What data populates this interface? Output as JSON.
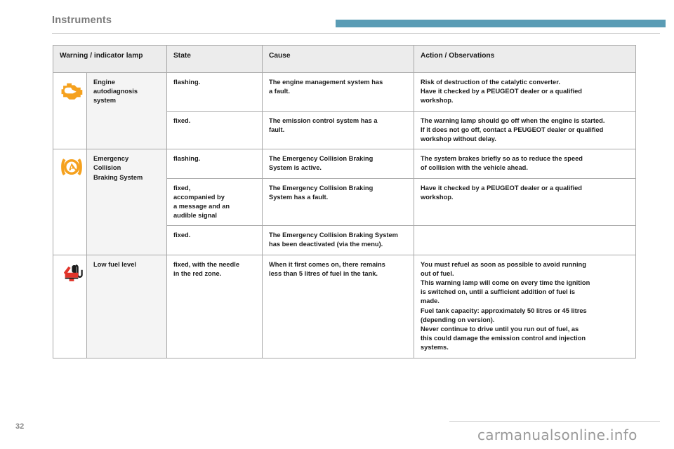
{
  "header": {
    "section_title": "Instruments",
    "accent_color": "#5a9cb5"
  },
  "table": {
    "columns": [
      {
        "key": "lamp",
        "label": "Warning / indicator lamp"
      },
      {
        "key": "state",
        "label": "State"
      },
      {
        "key": "cause",
        "label": "Cause"
      },
      {
        "key": "action",
        "label": "Action / Observations"
      }
    ],
    "groups": [
      {
        "icon": "engine-autodiagnosis-icon",
        "icon_color": "#f5a11e",
        "name_lines": [
          "Engine",
          "autodiagnosis",
          "system"
        ],
        "rows": [
          {
            "state": [
              "flashing."
            ],
            "cause": [
              "The engine management system has",
              "a fault."
            ],
            "action": [
              "Risk of destruction of the catalytic converter.",
              "Have it checked by a PEUGEOT dealer or a qualified",
              "workshop."
            ]
          },
          {
            "state": [
              "fixed."
            ],
            "cause": [
              "The emission control system has a",
              "fault."
            ],
            "action": [
              "The warning lamp should go off when the engine is started.",
              "If it does not go off, contact a PEUGEOT dealer or qualified",
              "workshop without delay."
            ]
          }
        ]
      },
      {
        "icon": "emergency-collision-braking-icon",
        "icon_color": "#f5a11e",
        "name_lines": [
          "Emergency",
          "Collision",
          "Braking System"
        ],
        "rows": [
          {
            "state": [
              "flashing."
            ],
            "cause": [
              "The Emergency Collision Braking",
              "System is active."
            ],
            "action": [
              "The system brakes briefly so as to reduce the speed",
              "of collision with the vehicle ahead."
            ]
          },
          {
            "state": [
              "fixed,",
              "accompanied by",
              "a message and an",
              "audible signal"
            ],
            "cause": [
              "The Emergency Collision Braking",
              "System has a fault."
            ],
            "action": [
              "Have it checked by a PEUGEOT dealer or a qualified",
              "workshop."
            ]
          },
          {
            "state": [
              "fixed."
            ],
            "cause": [
              "The Emergency Collision Braking System",
              "has been deactivated (via the menu)."
            ],
            "action": []
          }
        ]
      },
      {
        "icon": "low-fuel-level-icon",
        "icon_color": "#e1342a",
        "name_lines": [
          "Low fuel level"
        ],
        "rows": [
          {
            "state": [
              "fixed, with the needle",
              "in the red zone."
            ],
            "cause": [
              "When it first comes on, there remains",
              "less than 5 litres of fuel in the tank."
            ],
            "action": [
              "You must refuel as soon as possible to avoid running",
              "out of fuel.",
              "This warning lamp will come on every time the ignition",
              "is switched on, until a sufficient addition of fuel is",
              "made.",
              "Fuel tank capacity: approximately 50 litres or 45 litres",
              "(depending on version).",
              "Never continue to drive until you run out of fuel, as",
              "this could damage the emission control and injection",
              "systems."
            ]
          }
        ]
      }
    ]
  },
  "footer": {
    "page_number": "32",
    "watermark": "carmanualsonline.info"
  }
}
